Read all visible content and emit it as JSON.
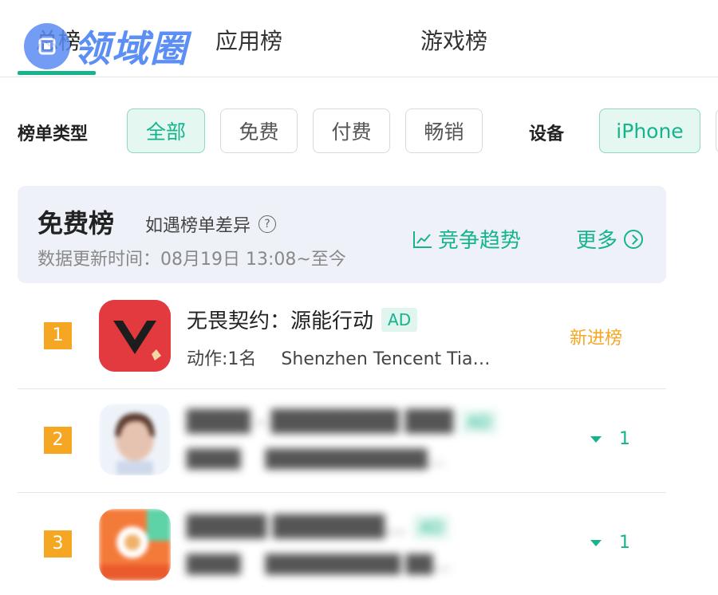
{
  "tabs": [
    "总榜",
    "应用榜",
    "游戏榜"
  ],
  "watermark": "领域圈",
  "filters": {
    "type_label": "榜单类型",
    "types": [
      "全部",
      "免费",
      "付费",
      "畅销"
    ],
    "device_label": "设备",
    "device": "iPhone"
  },
  "card": {
    "title": "免费榜",
    "note": "如遇榜单差异",
    "update": "数据更新时间：08月19日 13:08~至今",
    "trend": "竞争趋势",
    "more": "更多"
  },
  "apps": [
    {
      "rank": "1",
      "name": "无畏契约：源能行动",
      "ad": "AD",
      "category": "动作:1名",
      "developer": "Shenzhen Tencent Tia…",
      "status": "新进榜"
    },
    {
      "rank": "2",
      "name": "████ - ████████ ███",
      "ad": "AD",
      "category": "████",
      "developer": "████████████…",
      "change": "1"
    },
    {
      "rank": "3",
      "name": "█████ ███████…",
      "ad": "AD",
      "category": "████",
      "developer": "██████████ ██…",
      "change": "1"
    }
  ],
  "colors": {
    "accent": "#17b38c",
    "rank": "#f5a623",
    "new_status": "#f5a623"
  }
}
